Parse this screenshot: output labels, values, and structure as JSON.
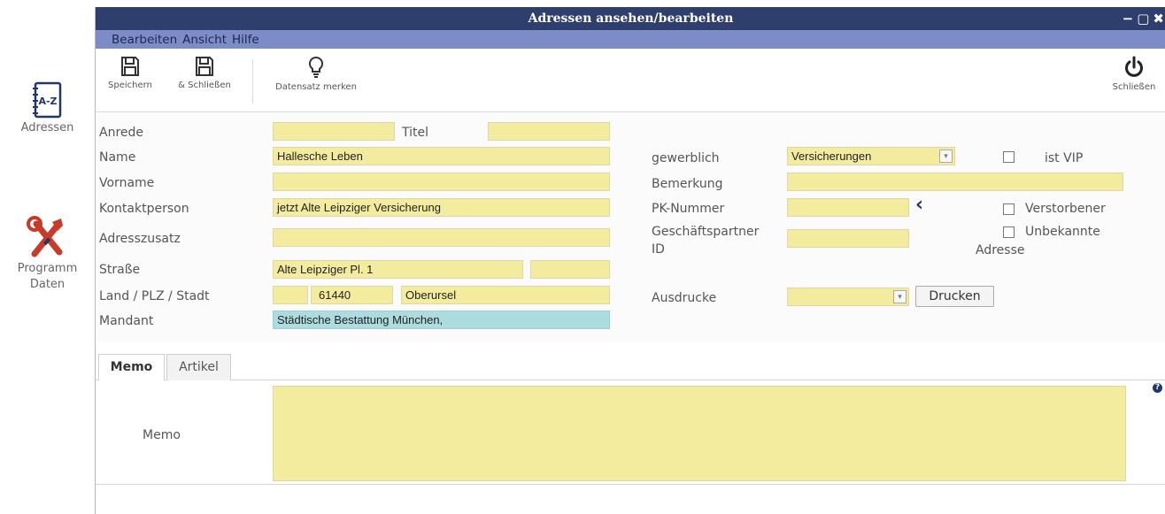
{
  "launcher": {
    "items": [
      {
        "label": "Adressen",
        "icon": "address-book-icon"
      },
      {
        "label_line1": "Programm",
        "label_line2": "Daten",
        "icon": "tools-icon"
      }
    ]
  },
  "window": {
    "title": "Adressen ansehen/bearbeiten",
    "controls": {
      "minimize": "−",
      "maximize": "▢",
      "close": "✖"
    }
  },
  "menu": [
    "Bearbeiten",
    "Ansicht",
    "Hilfe"
  ],
  "toolbar": {
    "save": "Speichern",
    "save_close": "& Schließen",
    "bookmark": "Datensatz merken",
    "close": "Schließen"
  },
  "form": {
    "labels": {
      "anrede": "Anrede",
      "titel": "Titel",
      "name": "Name",
      "vorname": "Vorname",
      "kontaktperson": "Kontaktperson",
      "adresszusatz": "Adresszusatz",
      "strasse": "Straße",
      "land_plz_stadt": "Land / PLZ / Stadt",
      "mandant": "Mandant",
      "gewerblich": "gewerblich",
      "bemerkung": "Bemerkung",
      "pk_nummer": "PK-Nummer",
      "gp_line1": "Geschäftspartner",
      "gp_line2": "ID",
      "ausdrucke": "Ausdrucke",
      "ist_vip": "ist VIP",
      "verstorbener": "Verstorbener",
      "unbekannte_line1": "Unbekannte",
      "unbekannte_line2": "Adresse"
    },
    "values": {
      "anrede": "",
      "titel": "",
      "name": "Hallesche Leben",
      "vorname": "",
      "kontaktperson": "jetzt Alte Leipziger Versicherung",
      "adresszusatz": "",
      "strasse": "Alte Leipziger Pl. 1",
      "hausnr": "",
      "land": "",
      "plz": "61440",
      "stadt": "Oberursel",
      "mandant": "Städtische Bestattung München,",
      "gewerblich": "Versicherungen",
      "bemerkung": "",
      "pk_nummer": "",
      "gp_id": "",
      "ausdrucke": ""
    },
    "checkboxes": {
      "ist_vip": false,
      "verstorbener": false,
      "unbekannte_adresse": false
    },
    "print_button": "Drucken",
    "pk_nav_glyph": "‹"
  },
  "tabs": [
    {
      "label": "Memo",
      "active": true
    },
    {
      "label": "Artikel",
      "active": false
    }
  ],
  "memo": {
    "label": "Memo",
    "value": "",
    "help": "?"
  },
  "colors": {
    "titlebar": "#2e3f6e",
    "menubar": "#7d8cc6",
    "field": "#f3ec9f",
    "mandant_field": "#acdce0"
  }
}
